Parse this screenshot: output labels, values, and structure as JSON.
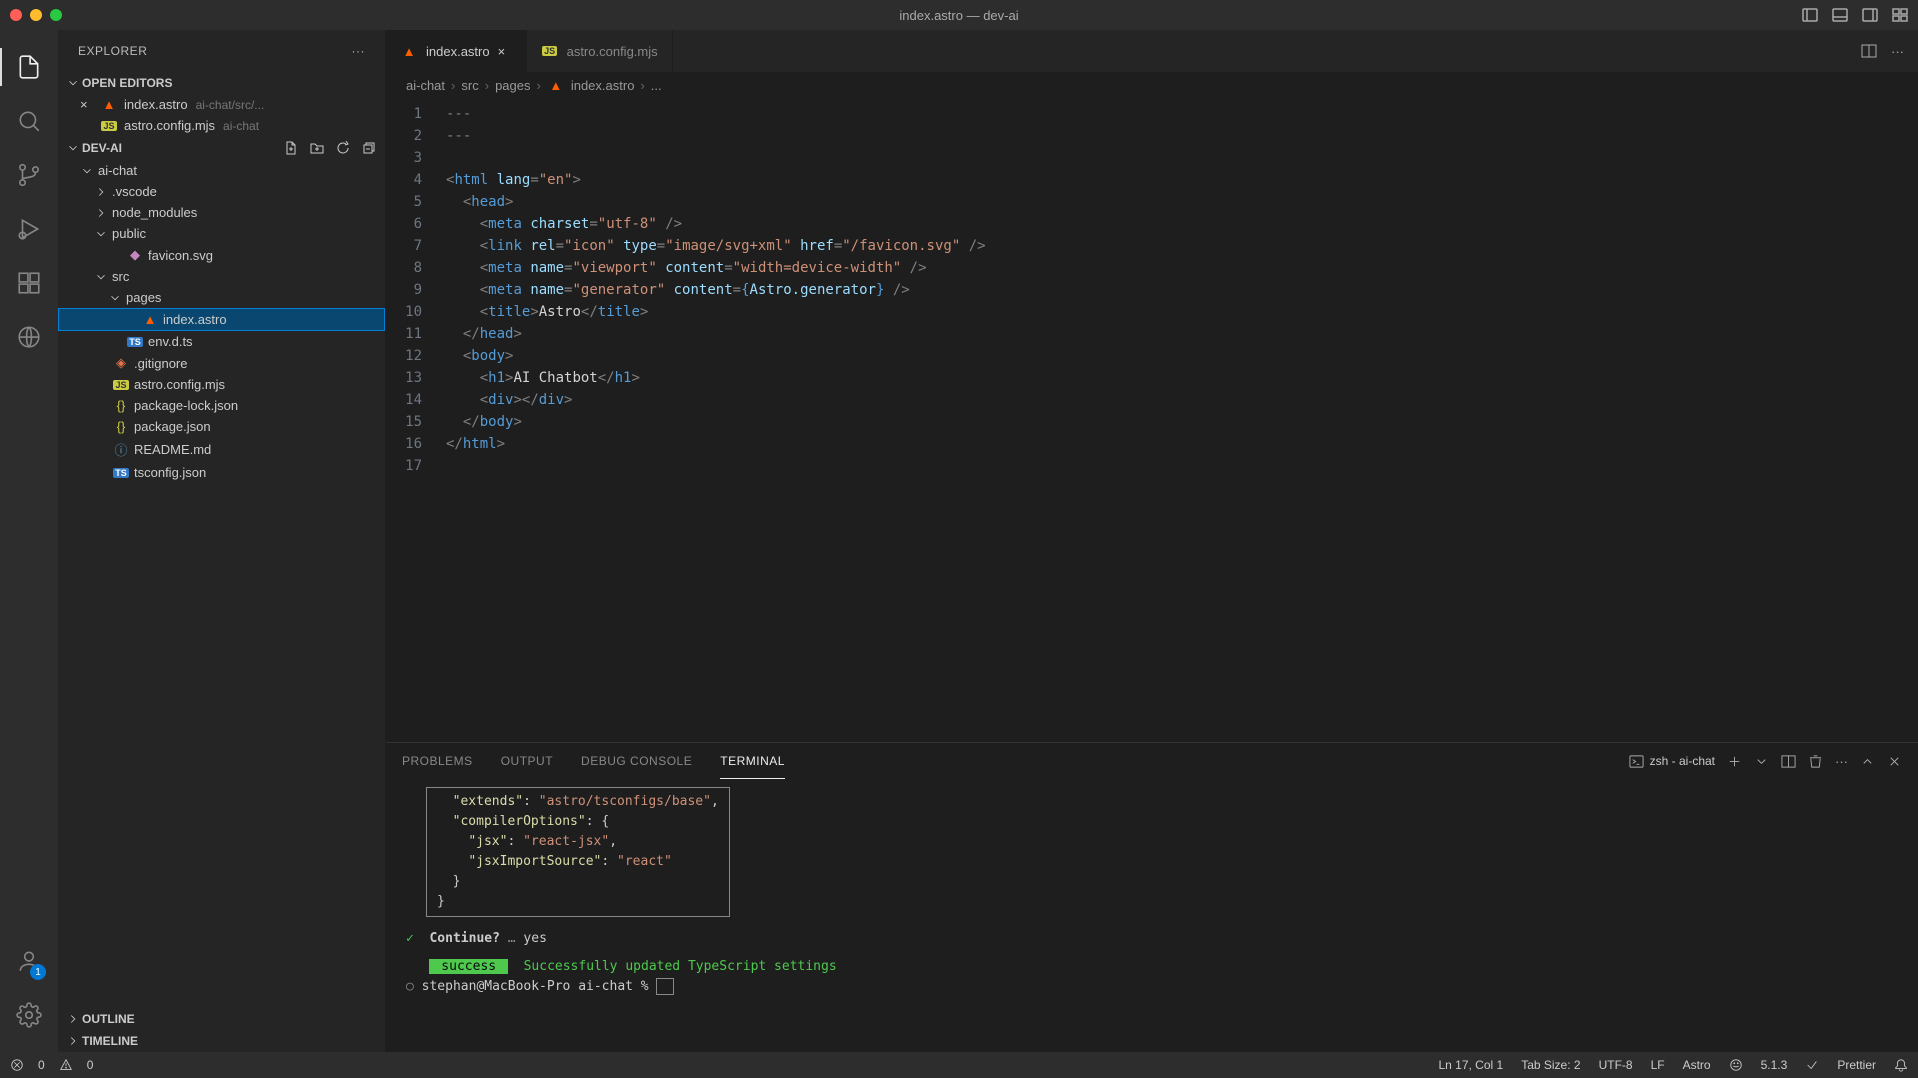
{
  "window": {
    "title": "index.astro — dev-ai"
  },
  "explorer": {
    "title": "EXPLORER",
    "open_editors_label": "OPEN EDITORS",
    "project_label": "DEV-AI",
    "outline_label": "OUTLINE",
    "timeline_label": "TIMELINE",
    "open_editors": [
      {
        "name": "index.astro",
        "meta": "ai-chat/src/...",
        "icon": "astro"
      },
      {
        "name": "astro.config.mjs",
        "meta": "ai-chat",
        "icon": "js"
      }
    ],
    "tree": {
      "root": "ai-chat",
      "items": [
        {
          "depth": 1,
          "type": "folder",
          "name": "ai-chat",
          "open": true
        },
        {
          "depth": 2,
          "type": "folder",
          "name": ".vscode",
          "open": false
        },
        {
          "depth": 2,
          "type": "folder",
          "name": "node_modules",
          "open": false
        },
        {
          "depth": 2,
          "type": "folder",
          "name": "public",
          "open": true
        },
        {
          "depth": 3,
          "type": "file",
          "name": "favicon.svg",
          "icon": "svg"
        },
        {
          "depth": 2,
          "type": "folder",
          "name": "src",
          "open": true
        },
        {
          "depth": 3,
          "type": "folder",
          "name": "pages",
          "open": true
        },
        {
          "depth": 4,
          "type": "file",
          "name": "index.astro",
          "icon": "astro",
          "selected": true
        },
        {
          "depth": 3,
          "type": "file",
          "name": "env.d.ts",
          "icon": "ts"
        },
        {
          "depth": 2,
          "type": "file",
          "name": ".gitignore",
          "icon": "git"
        },
        {
          "depth": 2,
          "type": "file",
          "name": "astro.config.mjs",
          "icon": "js"
        },
        {
          "depth": 2,
          "type": "file",
          "name": "package-lock.json",
          "icon": "json"
        },
        {
          "depth": 2,
          "type": "file",
          "name": "package.json",
          "icon": "json"
        },
        {
          "depth": 2,
          "type": "file",
          "name": "README.md",
          "icon": "md"
        },
        {
          "depth": 2,
          "type": "file",
          "name": "tsconfig.json",
          "icon": "ts"
        }
      ]
    }
  },
  "tabs": [
    {
      "name": "index.astro",
      "icon": "astro",
      "active": true
    },
    {
      "name": "astro.config.mjs",
      "icon": "js",
      "active": false
    }
  ],
  "breadcrumb": [
    "ai-chat",
    "src",
    "pages",
    "index.astro",
    "..."
  ],
  "code": {
    "lines_count": 17,
    "lines": [
      "---",
      "---",
      "",
      "<html lang=\"en\">",
      "  <head>",
      "    <meta charset=\"utf-8\" />",
      "    <link rel=\"icon\" type=\"image/svg+xml\" href=\"/favicon.svg\" />",
      "    <meta name=\"viewport\" content=\"width=device-width\" />",
      "    <meta name=\"generator\" content={Astro.generator} />",
      "    <title>Astro</title>",
      "  </head>",
      "  <body>",
      "    <h1>AI Chatbot</h1>",
      "    <div></div>",
      "  </body>",
      "</html>",
      ""
    ]
  },
  "panel": {
    "tabs": [
      "PROBLEMS",
      "OUTPUT",
      "DEBUG CONSOLE",
      "TERMINAL"
    ],
    "active_tab": "TERMINAL",
    "terminal_label": "zsh - ai-chat",
    "terminal_lines": [
      {
        "box_line": "  \"extends\": \"astro/tsconfigs/base\","
      },
      {
        "box_line": "  \"compilerOptions\": {"
      },
      {
        "box_line": "    \"jsx\": \"react-jsx\","
      },
      {
        "box_line": "    \"jsxImportSource\": \"react\""
      },
      {
        "box_line": "  }"
      },
      {
        "box_line": "}"
      }
    ],
    "continue_prompt": "Continue?",
    "continue_answer": "yes",
    "success_label": "success",
    "success_msg": "Successfully updated TypeScript settings",
    "prompt": "stephan@MacBook-Pro ai-chat % "
  },
  "status": {
    "errors": "0",
    "warnings": "0",
    "cursor": "Ln 17, Col 1",
    "tab_size": "Tab Size: 2",
    "encoding": "UTF-8",
    "eol": "LF",
    "language": "Astro",
    "version": "5.1.3",
    "prettier": "Prettier"
  },
  "activity_badge": "1"
}
